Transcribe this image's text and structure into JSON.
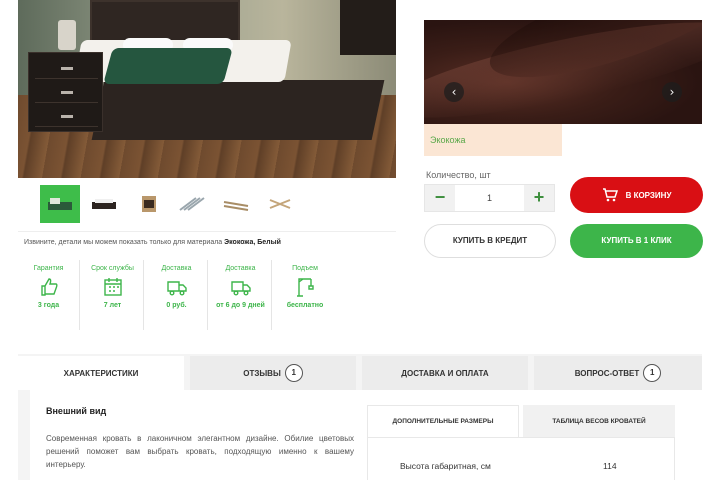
{
  "colors": {
    "accent_green": "#3db54a",
    "cart_red": "#d90f14",
    "swatch_bg": "#fbe6d4"
  },
  "gallery": {
    "thumbnails": [
      "bed-thumb",
      "bed-dark-thumb",
      "wood-thumb",
      "slats-thumb",
      "frame-thumb",
      "frame-detail-thumb"
    ],
    "note_prefix": "Извините, детали мы можем показать только для материала ",
    "note_material": "Экокожа, Белый"
  },
  "fabric": {
    "prev_icon": "chevron-left-icon",
    "next_icon": "chevron-right-icon",
    "swatch_label": "Экокожа"
  },
  "quantity": {
    "label": "Количество, шт",
    "minus": "−",
    "value": "1",
    "plus": "+"
  },
  "buttons": {
    "cart": "В КОРЗИНУ",
    "credit": "КУПИТЬ В КРЕДИТ",
    "one_click": "КУПИТЬ В 1 КЛИК"
  },
  "features": [
    {
      "title": "Гарантия",
      "icon": "thumbs-up-icon",
      "value": "3 года"
    },
    {
      "title": "Срок службы",
      "icon": "calendar-icon",
      "value": "7 лет"
    },
    {
      "title": "Доставка",
      "icon": "truck-icon",
      "value": "0 руб."
    },
    {
      "title": "Доставка",
      "icon": "truck-icon",
      "value": "от 6 до 9 дней"
    },
    {
      "title": "Подъем",
      "icon": "crane-icon",
      "value": "бесплатно"
    }
  ],
  "tabs": [
    {
      "label": "ХАРАКТЕРИСТИКИ",
      "count": ""
    },
    {
      "label": "ОТЗЫВЫ",
      "count": "1"
    },
    {
      "label": "ДОСТАВКА И ОПЛАТА",
      "count": ""
    },
    {
      "label": "ВОПРОС-ОТВЕТ",
      "count": "1"
    }
  ],
  "description": {
    "title": "Внешний вид",
    "text": "Современная кровать в лаконичном элегантном дизайне. Обилие цветовых решений поможет вам выбрать кровать, подходящую именно к вашему интерьеру."
  },
  "spec_tabs": [
    "ДОПОЛНИТЕЛЬНЫЕ РАЗМЕРЫ",
    "ТАБЛИЦА ВЕСОВ КРОВАТЕЙ"
  ],
  "spec_row": {
    "label": "Высота габаритная, см",
    "value": "114"
  }
}
